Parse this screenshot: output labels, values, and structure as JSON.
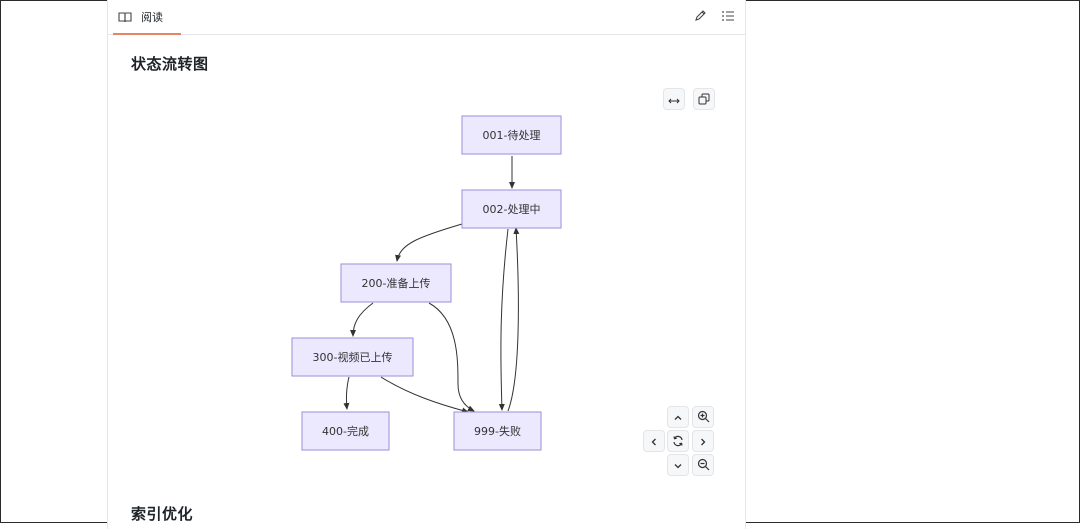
{
  "tabs": {
    "read_label": "阅读"
  },
  "icons": {
    "tab": "book-icon",
    "edit": "pencil-icon",
    "outline": "list-icon",
    "fit": "arrows-horizontal-icon",
    "copy": "copy-icon",
    "pan_up": "chevron-up-icon",
    "pan_down": "chevron-down-icon",
    "pan_left": "chevron-left-icon",
    "pan_right": "chevron-right-icon",
    "reset": "refresh-icon",
    "zoom_in": "zoom-in-icon",
    "zoom_out": "zoom-out-icon"
  },
  "sections": {
    "state_flow_title": "状态流转图",
    "index_title": "索引优化"
  },
  "diagram": {
    "nodes": {
      "n001": "001-待处理",
      "n002": "002-处理中",
      "n200": "200-准备上传",
      "n300": "300-视频已上传",
      "n400": "400-完成",
      "n999": "999-失败"
    },
    "edges": [
      [
        "n001",
        "n002"
      ],
      [
        "n002",
        "n200"
      ],
      [
        "n002",
        "n999"
      ],
      [
        "n999",
        "n002"
      ],
      [
        "n200",
        "n300"
      ],
      [
        "n200",
        "n999"
      ],
      [
        "n300",
        "n400"
      ],
      [
        "n300",
        "n999"
      ]
    ]
  },
  "colors": {
    "accent": "#e8845f",
    "node_fill": "#ece9fe",
    "node_stroke": "#9b8ed8"
  }
}
